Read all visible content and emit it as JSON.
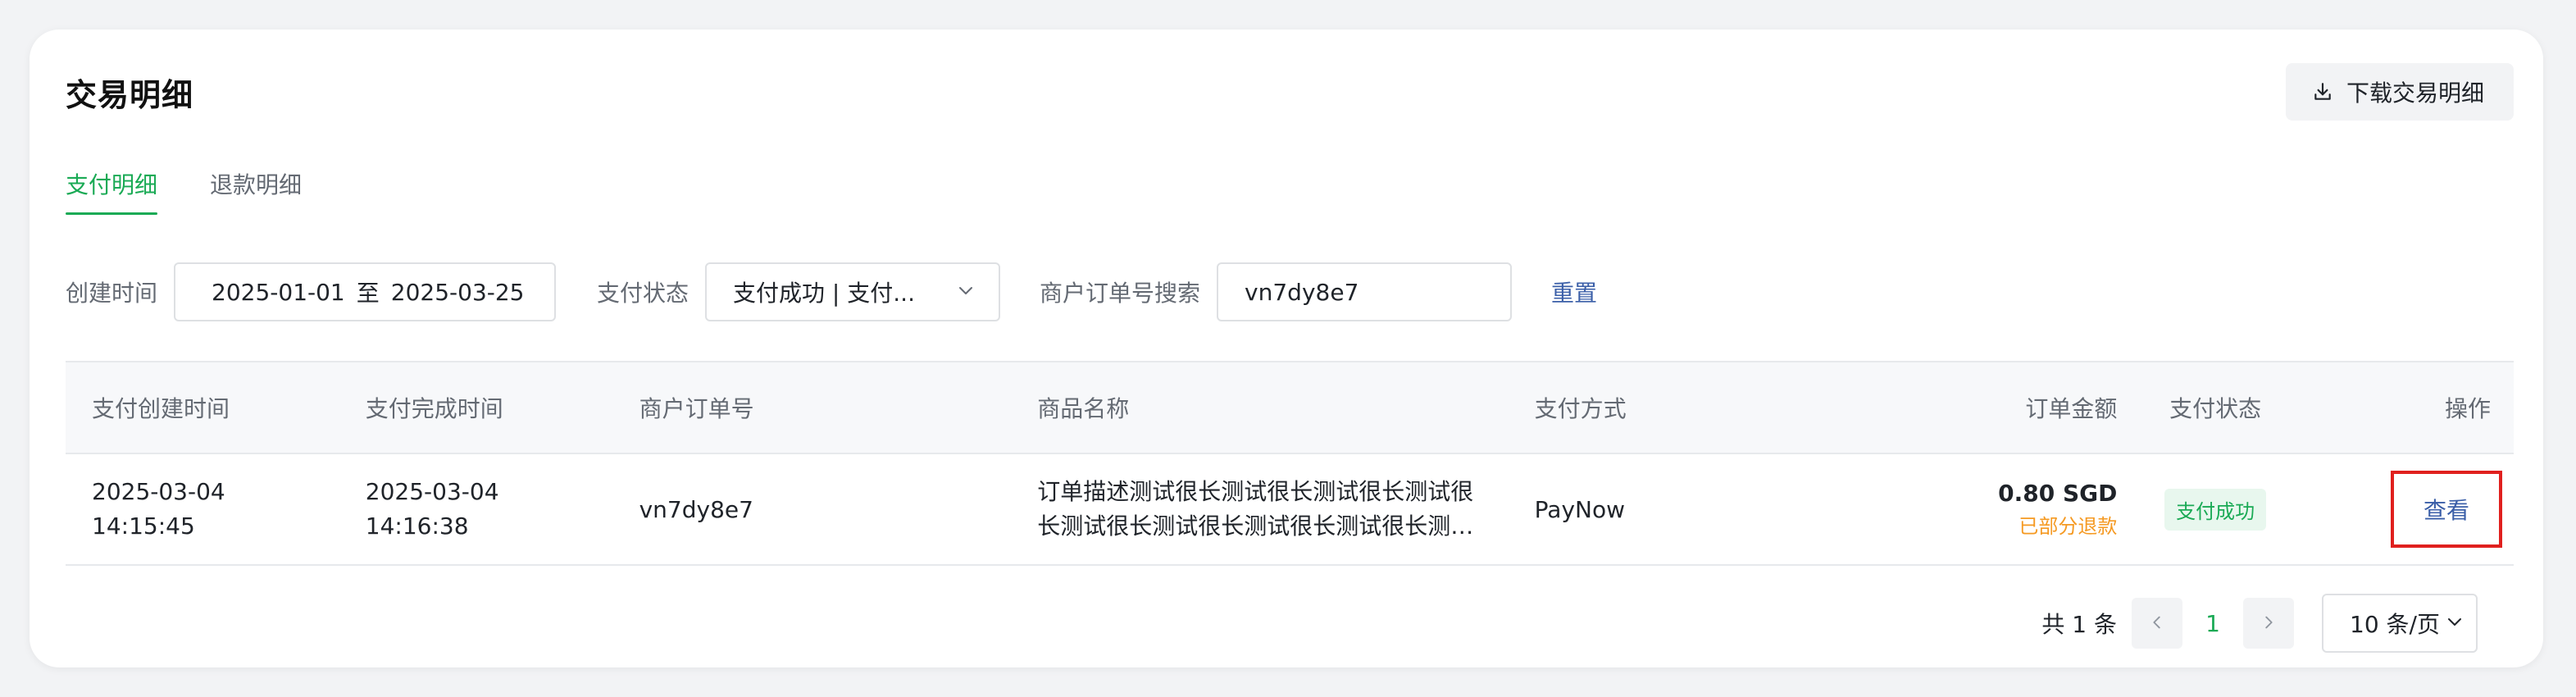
{
  "page": {
    "title": "交易明细",
    "download_label": "下载交易明细"
  },
  "tabs": [
    {
      "label": "支付明细",
      "active": true
    },
    {
      "label": "退款明细",
      "active": false
    }
  ],
  "filters": {
    "created_time_label": "创建时间",
    "date_start": "2025-01-01",
    "date_sep": "至",
    "date_end": "2025-03-25",
    "status_label": "支付状态",
    "status_value": "支付成功 | 支付...",
    "order_search_label": "商户订单号搜索",
    "order_search_value": "vn7dy8e7",
    "reset_label": "重置"
  },
  "table": {
    "columns": [
      "支付创建时间",
      "支付完成时间",
      "商户订单号",
      "商品名称",
      "支付方式",
      "订单金额",
      "支付状态",
      "操作"
    ],
    "rows": [
      {
        "created_date": "2025-03-04",
        "created_time": "14:15:45",
        "finished_date": "2025-03-04",
        "finished_time": "14:16:38",
        "order_no": "vn7dy8e7",
        "goods_name": "订单描述测试很长测试很长测试很长测试很长测试很长测试很长测试很长测试很长测试很长测…",
        "pay_method": "PayNow",
        "amount": "0.80 SGD",
        "refund_status": "已部分退款",
        "pay_status": "支付成功",
        "action": "查看"
      }
    ]
  },
  "pagination": {
    "total_label": "共 1 条",
    "current_page": "1",
    "page_size": "10 条/页"
  },
  "colors": {
    "accent_green": "#1aaa55",
    "link_blue": "#3b5fa8",
    "warning_orange": "#f59a23",
    "highlight_red": "#e0201e"
  },
  "icons": {
    "download": "download-icon",
    "select_arrow": "chevron-down-icon",
    "prev": "chevron-left-icon",
    "next": "chevron-right-icon"
  }
}
